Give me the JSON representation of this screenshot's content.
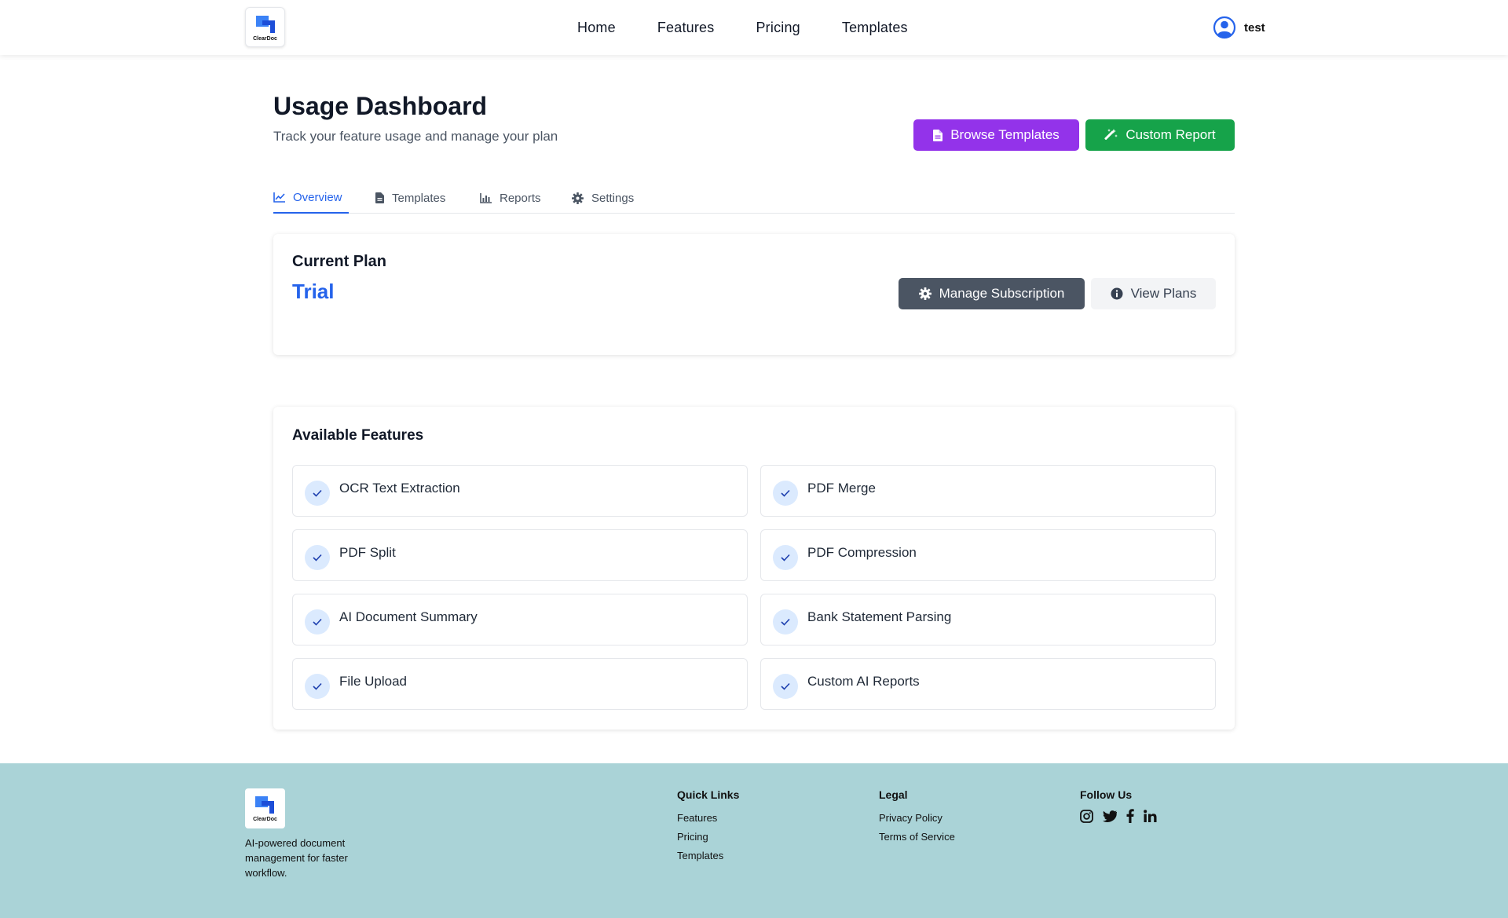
{
  "header": {
    "logo_text": "ClearDoc",
    "nav": [
      "Home",
      "Features",
      "Pricing",
      "Templates"
    ],
    "user_name": "test"
  },
  "page": {
    "title": "Usage Dashboard",
    "subtitle": "Track your feature usage and manage your plan",
    "browse_templates_label": "Browse Templates",
    "custom_report_label": "Custom Report"
  },
  "tabs": [
    {
      "label": "Overview",
      "icon": "chart-line-icon",
      "active": true
    },
    {
      "label": "Templates",
      "icon": "document-icon",
      "active": false
    },
    {
      "label": "Reports",
      "icon": "bar-chart-icon",
      "active": false
    },
    {
      "label": "Settings",
      "icon": "gear-icon",
      "active": false
    }
  ],
  "plan": {
    "label": "Current Plan",
    "value": "Trial",
    "manage_label": "Manage Subscription",
    "view_plans_label": "View Plans"
  },
  "features": {
    "title": "Available Features",
    "items": [
      "OCR Text Extraction",
      "PDF Merge",
      "PDF Split",
      "PDF Compression",
      "AI Document Summary",
      "Bank Statement Parsing",
      "File Upload",
      "Custom AI Reports"
    ]
  },
  "footer": {
    "logo_text": "ClearDoc",
    "description": "AI-powered document management for faster workflow.",
    "quick_links_title": "Quick Links",
    "quick_links": [
      "Features",
      "Pricing",
      "Templates"
    ],
    "legal_title": "Legal",
    "legal_links": [
      "Privacy Policy",
      "Terms of Service"
    ],
    "follow_title": "Follow Us",
    "social_icons": [
      "instagram-icon",
      "twitter-icon",
      "facebook-icon",
      "linkedin-icon"
    ]
  },
  "colors": {
    "primary": "#2563eb",
    "browse_button": "#9333ea",
    "custom_button": "#16a34a",
    "manage_button": "#4b5563",
    "footer_bg": "#aad3d7"
  }
}
